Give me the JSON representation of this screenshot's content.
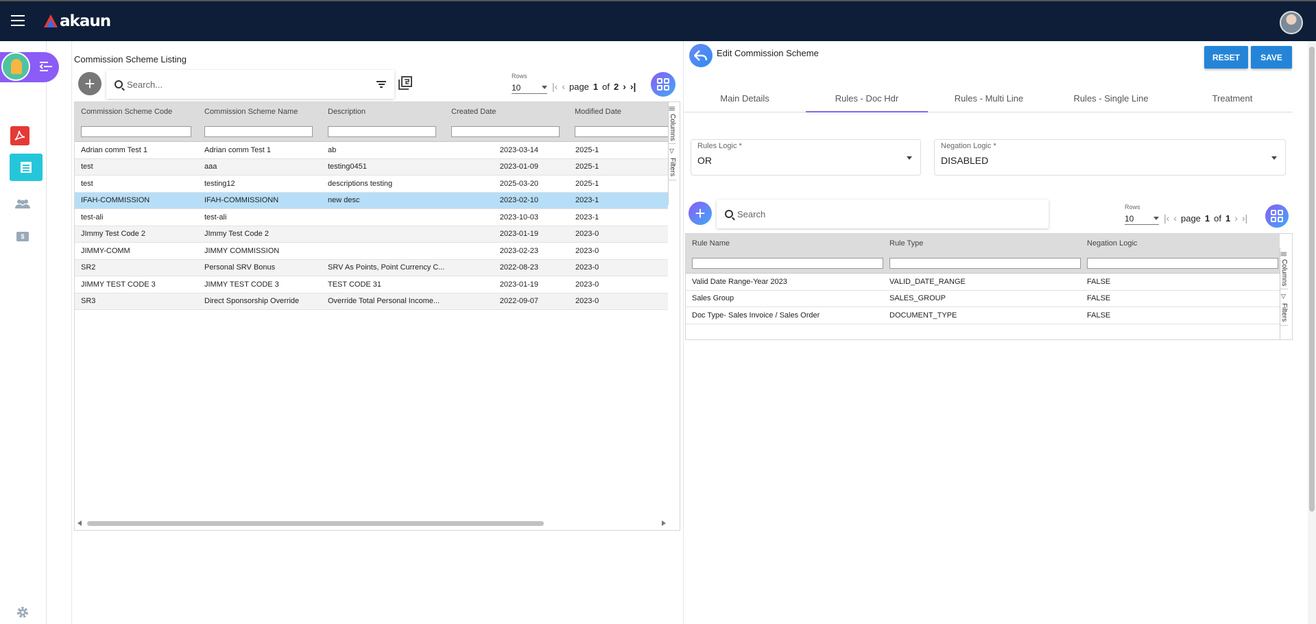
{
  "app": {
    "logo_text": "akaun"
  },
  "sidebar": {
    "items": [
      {
        "name": "app-switcher"
      },
      {
        "name": "pdf-app"
      },
      {
        "name": "documents"
      },
      {
        "name": "people"
      },
      {
        "name": "cash"
      },
      {
        "name": "settings"
      }
    ],
    "cash_label": "$"
  },
  "listing": {
    "title": "Commission Scheme Listing",
    "search_placeholder": "Search...",
    "rows_label": "Rows",
    "rows_value": "10",
    "page_word": "page",
    "page_current": "1",
    "of_word": "of",
    "page_total": "2",
    "columns": [
      "Commission Scheme Code",
      "Commission Scheme Name",
      "Description",
      "Created Date",
      "Modified Date"
    ],
    "rows": [
      {
        "code": "Adrian comm Test 1",
        "name": "Adrian comm Test 1",
        "desc": "ab",
        "created": "2023-03-14",
        "modified": "2025-1",
        "selected": false
      },
      {
        "code": "test",
        "name": "aaa",
        "desc": "testing0451",
        "created": "2023-01-09",
        "modified": "2025-1",
        "selected": false
      },
      {
        "code": "test",
        "name": "testing12",
        "desc": "descriptions testing",
        "created": "2025-03-20",
        "modified": "2025-1",
        "selected": false
      },
      {
        "code": "IFAH-COMMISSION",
        "name": "IFAH-COMMISSIONN",
        "desc": "new desc",
        "created": "2023-02-10",
        "modified": "2023-1",
        "selected": true
      },
      {
        "code": "test-ali",
        "name": "test-ali",
        "desc": "",
        "created": "2023-10-03",
        "modified": "2023-1",
        "selected": false
      },
      {
        "code": "JImmy Test Code 2",
        "name": "JImmy Test Code 2",
        "desc": "",
        "created": "2023-01-19",
        "modified": "2023-0",
        "selected": false
      },
      {
        "code": "JIMMY-COMM",
        "name": "JIMMY COMMISSION",
        "desc": "",
        "created": "2023-02-23",
        "modified": "2023-0",
        "selected": false
      },
      {
        "code": "SR2",
        "name": "Personal SRV Bonus",
        "desc": "SRV As Points, Point Currency C...",
        "created": "2022-08-23",
        "modified": "2023-0",
        "selected": false
      },
      {
        "code": "JIMMY TEST CODE 3",
        "name": "JIMMY TEST CODE 3",
        "desc": "TEST CODE 31",
        "created": "2023-01-19",
        "modified": "2023-0",
        "selected": false
      },
      {
        "code": "SR3",
        "name": "Direct Sponsorship Override",
        "desc": "Override Total Personal Income...",
        "created": "2022-09-07",
        "modified": "2023-0",
        "selected": false
      }
    ],
    "side_tabs": [
      "Columns",
      "Filters"
    ]
  },
  "edit": {
    "title": "Edit Commission Scheme",
    "reset_label": "RESET",
    "save_label": "SAVE",
    "tabs": [
      "Main Details",
      "Rules - Doc Hdr",
      "Rules - Multi Line",
      "Rules - Single Line",
      "Treatment"
    ],
    "active_tab": 1,
    "rules_logic": {
      "label": "Rules Logic *",
      "value": "OR"
    },
    "negation_logic": {
      "label": "Negation Logic *",
      "value": "DISABLED"
    },
    "search_placeholder": "Search",
    "rows_label": "Rows",
    "rows_value": "10",
    "page_word": "page",
    "page_current": "1",
    "of_word": "of",
    "page_total": "1",
    "columns": [
      "Rule Name",
      "Rule Type",
      "Negation Logic"
    ],
    "rows": [
      {
        "name": "Valid Date Range-Year 2023",
        "type": "VALID_DATE_RANGE",
        "neg": "FALSE"
      },
      {
        "name": "Sales Group",
        "type": "SALES_GROUP",
        "neg": "FALSE"
      },
      {
        "name": "Doc Type- Sales Invoice / Sales Order",
        "type": "DOCUMENT_TYPE",
        "neg": "FALSE"
      }
    ],
    "side_tabs": [
      "Columns",
      "Filters"
    ]
  },
  "colors": {
    "topbar": "#0e1e38",
    "accent_purple": "#8b5cf6",
    "button_blue": "#2485d8",
    "selected_row": "#b7def7",
    "teal": "#26c6da"
  }
}
